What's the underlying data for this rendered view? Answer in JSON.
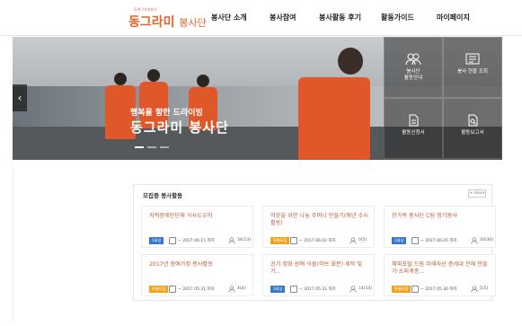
{
  "header": {
    "logo_small": "동래구자원봉사",
    "logo_main": "동그라미",
    "logo_sub": "봉사단",
    "nav": [
      "봉사단 소개",
      "봉사참여",
      "봉사활동 후기",
      "활동가이드",
      "마이페이지"
    ]
  },
  "hero": {
    "subtitle": "행복을 향한 드라이빙",
    "title": "동그라미 봉사단",
    "prev_icon": "chevron-left-icon"
  },
  "quick_links": [
    {
      "label": "봉사단\n활동안내",
      "icon": "people-icon"
    },
    {
      "label": "봉사 현황 조회",
      "icon": "list-window-icon"
    },
    {
      "label": "활동신청서",
      "icon": "document-edit-icon"
    },
    {
      "label": "활동보고서",
      "icon": "document-search-icon"
    }
  ],
  "board": {
    "title": "모집중 봉사활동",
    "more_label": "+ more",
    "cards": [
      {
        "title": "지적장애인단체 식사도우미",
        "badge": "1회성",
        "badge_color": "#3a78c9",
        "date": "~ 2017.06.15 까지",
        "count": "34(13)"
      },
      {
        "title": "이웃을 위한 나눔 주머니 만들기(매년 수시 활동)",
        "badge": "특별모집",
        "badge_color": "#f0a41c",
        "date": "~ 2017.06.02 까지",
        "count": "0(5)"
      },
      {
        "title": "한가족 봉사단 C팀 정기봉사",
        "badge": "1회성",
        "badge_color": "#3a78c9",
        "date": "~ 2017.06.05 까지",
        "count": "20(30)"
      },
      {
        "title": "2017년 장애가정 봉사활동",
        "badge": "특별모집",
        "badge_color": "#f0a41c",
        "date": "~ 2017.05.31 까지",
        "count": "4(4)"
      },
      {
        "title": "공기 정화 원예 식물(허브 화분) 제작 및 기...",
        "badge": "1회성",
        "badge_color": "#3a78c9",
        "date": "~ 2017.05.31 까지",
        "count": "14(14)"
      },
      {
        "title": "해피포털 드림 미래자산 층세대 전해 만들기·소외계층…",
        "badge": "특별모집",
        "badge_color": "#f0a41c",
        "date": "~ 2017.05.30 까지",
        "count": "5(5)"
      }
    ]
  }
}
